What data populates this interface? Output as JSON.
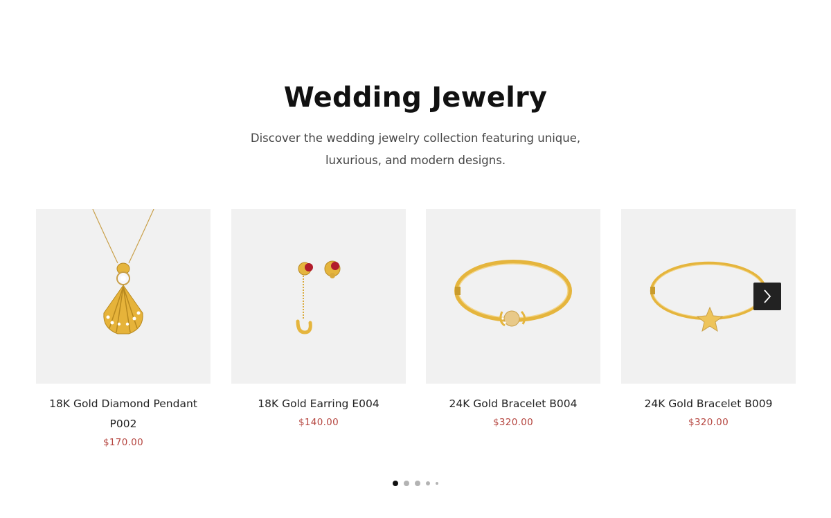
{
  "section": {
    "title": "Wedding Jewelry",
    "subtitle": "Discover the wedding jewelry collection featuring unique, luxurious, and modern designs."
  },
  "products": [
    {
      "name": "18K Gold Diamond Pendant P002",
      "price": "$170.00",
      "image": "gold-shell-pendant-icon"
    },
    {
      "name": "18K Gold Earring E004",
      "price": "$140.00",
      "image": "gold-ruby-earrings-icon"
    },
    {
      "name": "24K Gold Bracelet B004",
      "price": "$320.00",
      "image": "gold-pearl-bangle-icon"
    },
    {
      "name": "24K Gold Bracelet B009",
      "price": "$320.00",
      "image": "gold-star-bangle-icon"
    }
  ],
  "carousel": {
    "next_icon": "chevron-right-icon",
    "pagination_count": 5,
    "active_page": 1
  },
  "colors": {
    "price": "#b5453f",
    "image_bg": "#f1f1f1",
    "gold": "#e2b33c",
    "nav_button": "#222222"
  }
}
